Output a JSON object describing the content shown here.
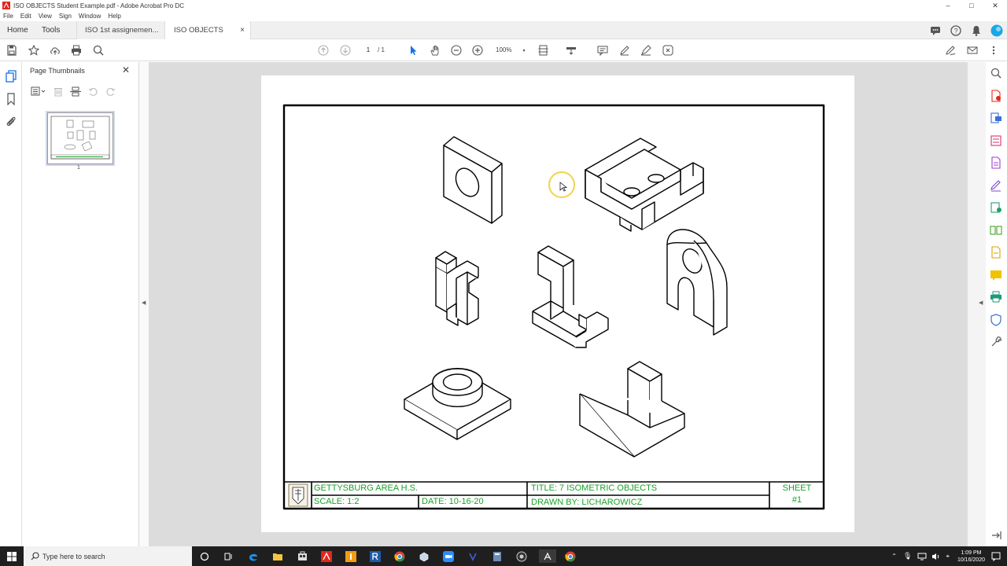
{
  "window": {
    "title": "ISO OBJECTS Student Example.pdf - Adobe Acrobat Pro DC"
  },
  "menu": [
    "File",
    "Edit",
    "View",
    "Sign",
    "Window",
    "Help"
  ],
  "tabs": {
    "home": "Home",
    "tools": "Tools",
    "doc1": "ISO 1st assignemen...",
    "doc2": "ISO OBJECTS Stude..."
  },
  "toolbar": {
    "page_current": "1",
    "page_of": "/ 1",
    "zoom": "100%"
  },
  "thumbnails": {
    "title": "Page Thumbnails",
    "page_label": "1"
  },
  "titleblock": {
    "school": "GETTYSBURG AREA H.S.",
    "title": "TITLE: 7 ISOMETRIC OBJECTS",
    "sheet": "SHEET",
    "sheet_num": "#1",
    "scale": "SCALE: 1:2",
    "date": "DATE: 10-16-20",
    "drawn_by": "DRAWN BY: LICHAROWICZ",
    "text_color": "#17a326"
  },
  "taskbar": {
    "search_placeholder": "Type here to search",
    "time": "1:09 PM",
    "date": "10/16/2020"
  },
  "colors": {
    "accent": "#1473e6",
    "acrobat_red": "#e2271b"
  }
}
